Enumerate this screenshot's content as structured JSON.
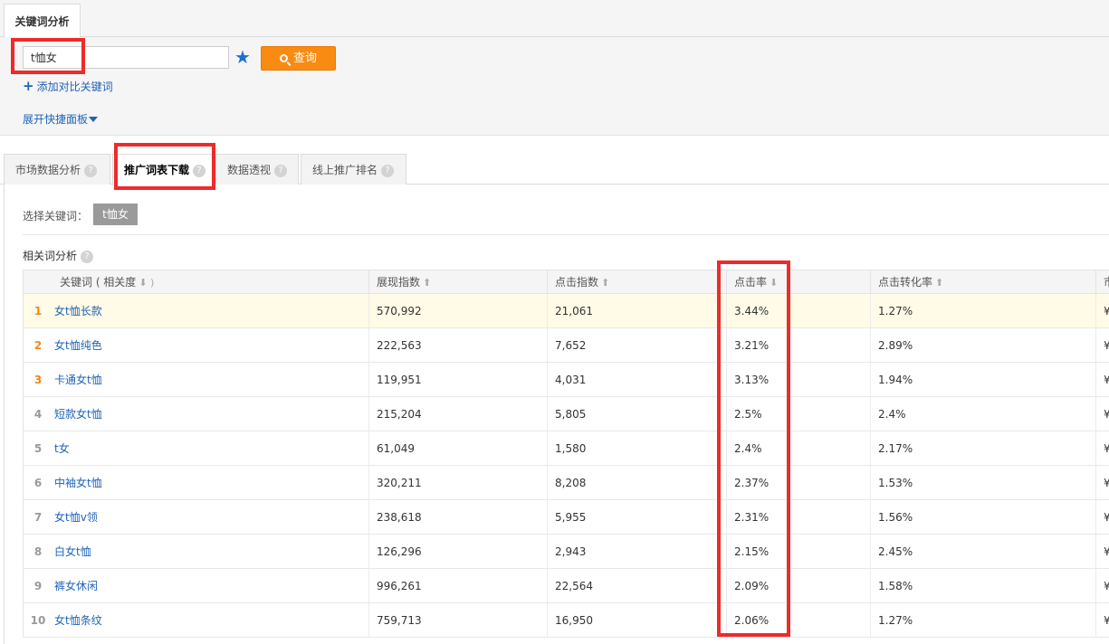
{
  "page_tab": "关键词分析",
  "search": {
    "value": "t恤女",
    "button": "查询"
  },
  "add_compare": "添加对比关键词",
  "expand_panel": "展开快捷面板",
  "tabs": [
    {
      "label": "市场数据分析"
    },
    {
      "label": "推广词表下载"
    },
    {
      "label": "数据透视"
    },
    {
      "label": "线上推广排名"
    }
  ],
  "select_keyword": {
    "label": "选择关键词：",
    "chip": "t恤女"
  },
  "section_title": "相关词分析",
  "table": {
    "headers": [
      "关键词 ( 相关度",
      "展现指数",
      "点击指数",
      "点击率",
      "点击转化率",
      "市"
    ],
    "header_arrows": [
      "⬇ )",
      "⬆",
      "⬆",
      "⬇",
      "⬆",
      ""
    ],
    "rows": [
      {
        "rank": "1",
        "keyword": "女t恤长款",
        "impression": "570,992",
        "clicks": "21,061",
        "ctr": "3.44%",
        "cvr": "1.27%",
        "price": "¥"
      },
      {
        "rank": "2",
        "keyword": "女t恤纯色",
        "impression": "222,563",
        "clicks": "7,652",
        "ctr": "3.21%",
        "cvr": "2.89%",
        "price": "¥"
      },
      {
        "rank": "3",
        "keyword": "卡通女t恤",
        "impression": "119,951",
        "clicks": "4,031",
        "ctr": "3.13%",
        "cvr": "1.94%",
        "price": "¥"
      },
      {
        "rank": "4",
        "keyword": "短款女t恤",
        "impression": "215,204",
        "clicks": "5,805",
        "ctr": "2.5%",
        "cvr": "2.4%",
        "price": "¥"
      },
      {
        "rank": "5",
        "keyword": "t女",
        "impression": "61,049",
        "clicks": "1,580",
        "ctr": "2.4%",
        "cvr": "2.17%",
        "price": "¥"
      },
      {
        "rank": "6",
        "keyword": "中袖女t恤",
        "impression": "320,211",
        "clicks": "8,208",
        "ctr": "2.37%",
        "cvr": "1.53%",
        "price": "¥"
      },
      {
        "rank": "7",
        "keyword": "女t恤v领",
        "impression": "238,618",
        "clicks": "5,955",
        "ctr": "2.31%",
        "cvr": "1.56%",
        "price": "¥"
      },
      {
        "rank": "8",
        "keyword": "白女t恤",
        "impression": "126,296",
        "clicks": "2,943",
        "ctr": "2.15%",
        "cvr": "2.45%",
        "price": "¥"
      },
      {
        "rank": "9",
        "keyword": "裤女休闲",
        "impression": "996,261",
        "clicks": "22,564",
        "ctr": "2.09%",
        "cvr": "1.58%",
        "price": "¥"
      },
      {
        "rank": "10",
        "keyword": "女t恤条纹",
        "impression": "759,713",
        "clicks": "16,950",
        "ctr": "2.06%",
        "cvr": "1.27%",
        "price": "¥"
      }
    ]
  },
  "colors": {
    "accent_orange": "#f98b13",
    "link_blue": "#1e63b8",
    "annotation_red": "#ee2b2b"
  }
}
